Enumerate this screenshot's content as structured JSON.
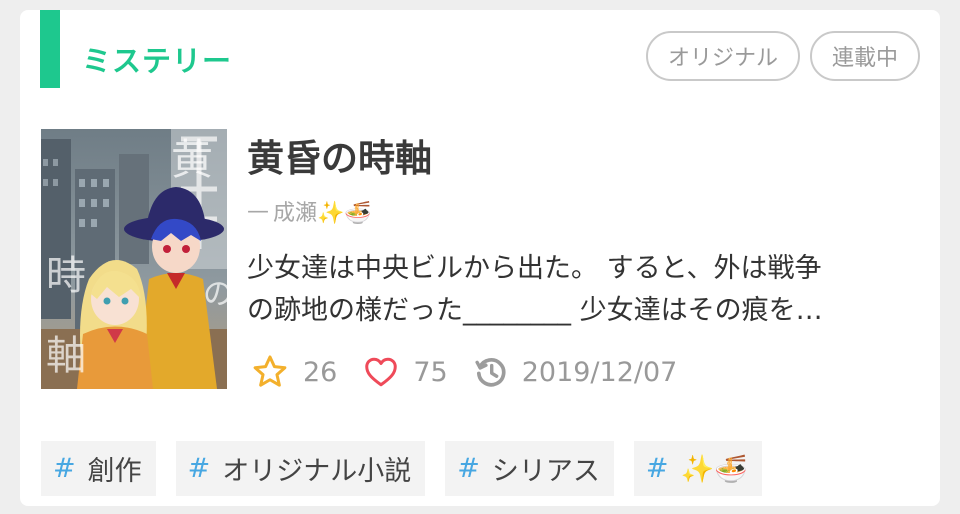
{
  "genre": "ミステリー",
  "status_pills": [
    "オリジナル",
    "連載中"
  ],
  "novel": {
    "title": "黄昏の時軸",
    "author_prefix": "—",
    "author": "成瀬✨🍜",
    "summary_lines": [
      "少女達は中央ビルから出た。 すると、外は戦争",
      "の跡地の様だった________ 少女達はその痕を…"
    ]
  },
  "stats": {
    "stars": "26",
    "likes": "75",
    "updated": "2019/12/07"
  },
  "tags": [
    {
      "hash": "#",
      "label": "創作"
    },
    {
      "hash": "#",
      "label": "オリジナル小説"
    },
    {
      "hash": "#",
      "label": "シリアス"
    },
    {
      "hash": "#",
      "label": "✨🍜"
    }
  ],
  "colors": {
    "accent": "#1ec88e",
    "star": "#f3b02c",
    "heart": "#ef4a59",
    "hash": "#47a7e2",
    "muted": "#999999"
  },
  "icons": [
    "star-icon",
    "heart-icon",
    "history-icon"
  ]
}
